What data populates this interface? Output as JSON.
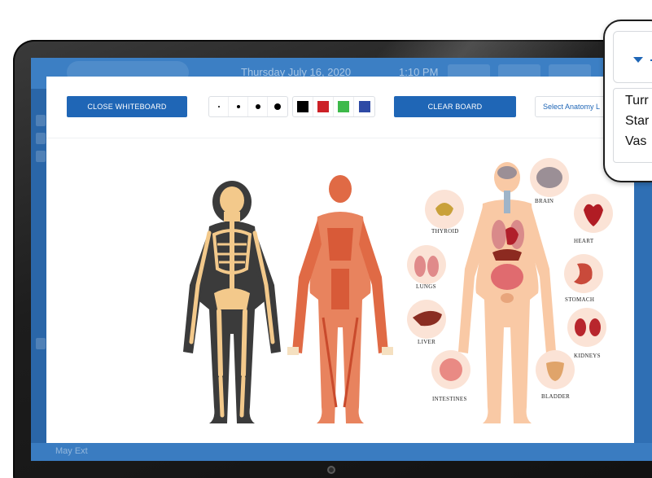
{
  "app": {
    "date_text": "Thursday July 16, 2020",
    "time_text": "1:10 PM",
    "bottom_user": "May Ext"
  },
  "whiteboard": {
    "close_label": "CLOSE WHITEBOARD",
    "clear_label": "CLEAR BOARD",
    "select_placeholder": "Select Anatomy L",
    "brush_sizes": [
      1,
      2,
      3,
      4
    ],
    "colors": [
      "#000000",
      "#cc2127",
      "#3db94a",
      "#2e4aa5"
    ]
  },
  "organs": {
    "thyroid": "THYROID",
    "lungs": "LUNGS",
    "liver": "LIVER",
    "intestines": "INTESTINES",
    "brain": "BRAIN",
    "heart": "HEART",
    "stomach": "STOMACH",
    "kidneys": "KIDNEYS",
    "bladder": "BLADDER"
  },
  "dropdown": {
    "items": [
      "Turr",
      "Star",
      "Vas"
    ],
    "accent": "#1f66b6"
  }
}
